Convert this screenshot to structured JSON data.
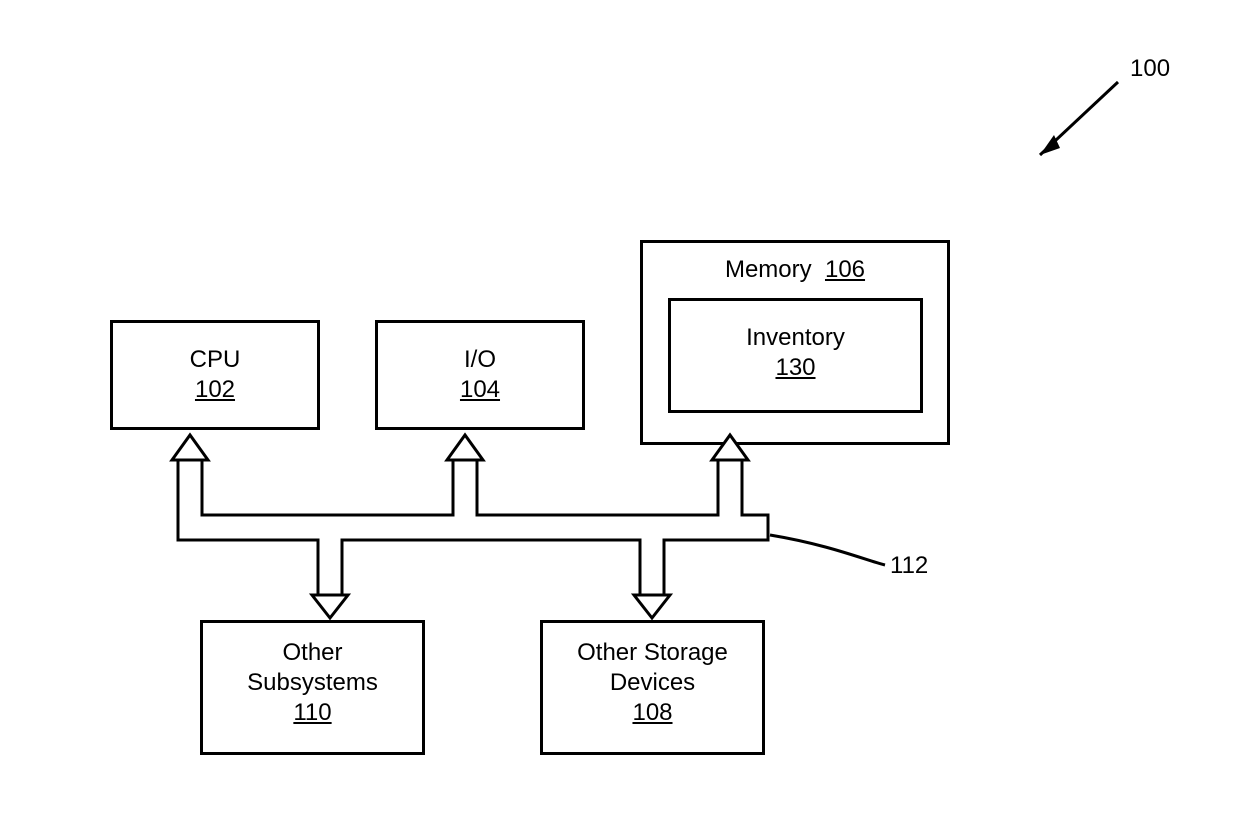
{
  "figure": {
    "ref": "100"
  },
  "blocks": {
    "cpu": {
      "label": "CPU",
      "ref": "102"
    },
    "io": {
      "label": "I/O",
      "ref": "104"
    },
    "memory": {
      "label": "Memory",
      "ref": "106"
    },
    "inventory": {
      "label": "Inventory",
      "ref": "130"
    },
    "other_subsystems": {
      "line1": "Other",
      "line2": "Subsystems",
      "ref": "110"
    },
    "other_storage_devices": {
      "line1": "Other Storage",
      "line2": "Devices",
      "ref": "108"
    }
  },
  "bus": {
    "ref": "112"
  }
}
